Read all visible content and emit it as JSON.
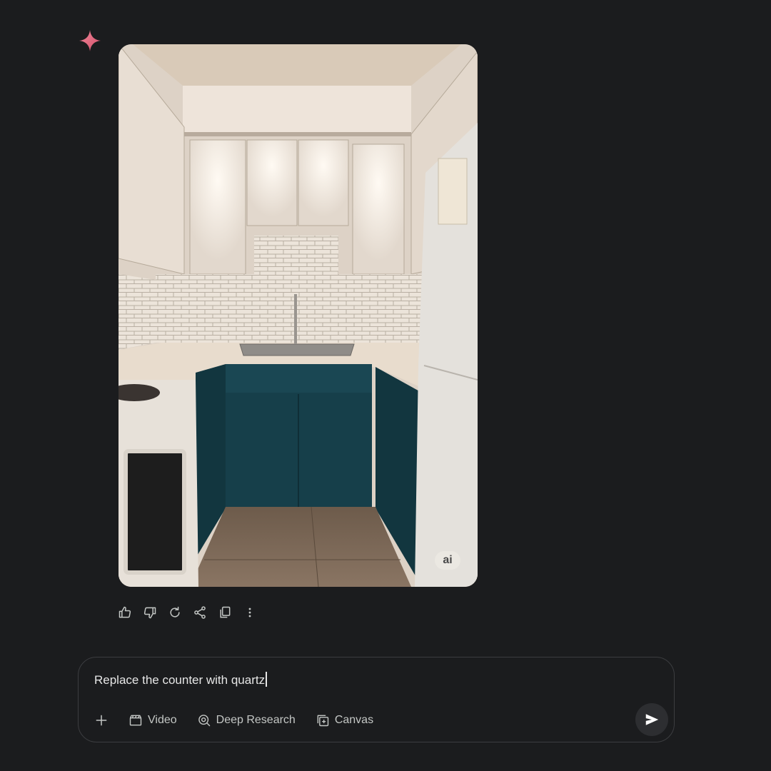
{
  "colors": {
    "background": "#1b1c1e",
    "sparkle": "#e0607a",
    "icon": "#c4c7c5",
    "composer_border": "#3c3d40",
    "send_button": "#2d2e31"
  },
  "response": {
    "logo_icon": "sparkle-icon",
    "image": {
      "alt": "Generated kitchen image",
      "badge": "ai"
    },
    "actions": [
      {
        "name": "thumbs-up-icon"
      },
      {
        "name": "thumbs-down-icon"
      },
      {
        "name": "regenerate-icon"
      },
      {
        "name": "share-icon"
      },
      {
        "name": "copy-icon"
      },
      {
        "name": "more-vert-icon"
      }
    ]
  },
  "composer": {
    "prompt_text": "Replace the counter with quartz",
    "tools": {
      "add_icon": "plus-icon",
      "video_label": "Video",
      "deep_research_label": "Deep Research",
      "canvas_label": "Canvas"
    },
    "send_icon": "send-icon"
  }
}
